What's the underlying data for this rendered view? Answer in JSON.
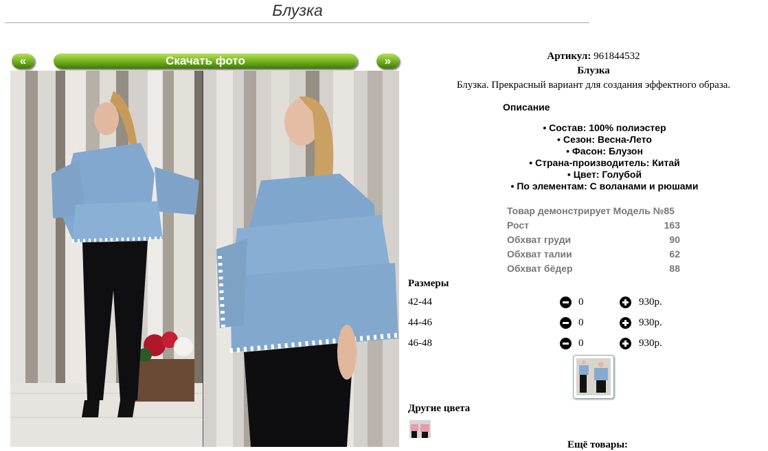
{
  "page": {
    "title": "Блузка"
  },
  "gallery": {
    "prev_label": "«",
    "download_label": "Скачать фото",
    "next_label": "»"
  },
  "product": {
    "article_label": "Артикул:",
    "article_value": "961844532",
    "name": "Блузка",
    "description": "Блузка. Прекрасный вариант для создания эффектного образа.",
    "description_heading": "Описание",
    "properties": [
      "Состав: 100% полиэстер",
      "Сезон: Весна-Лето",
      "Фасон: Блузон",
      "Страна-производитель: Китай",
      "Цвет: Голубой",
      "По элементам: С воланами и рюшами"
    ]
  },
  "model": {
    "rows": [
      {
        "label": "Товар демонстрирует Модель №85",
        "value": ""
      },
      {
        "label": "Рост",
        "value": "163"
      },
      {
        "label": "Обхват груди",
        "value": "90"
      },
      {
        "label": "Обхват талии",
        "value": "62"
      },
      {
        "label": "Обхват бёдер",
        "value": "88"
      }
    ]
  },
  "sizes": {
    "heading": "Размеры",
    "rows": [
      {
        "size": "42-44",
        "qty": "0",
        "price": "930р."
      },
      {
        "size": "44-46",
        "qty": "0",
        "price": "930р."
      },
      {
        "size": "46-48",
        "qty": "0",
        "price": "930р."
      }
    ]
  },
  "other_colors": {
    "heading": "Другие цвета"
  },
  "more": {
    "heading": "Ещё товары:"
  },
  "colors": {
    "button_green": "#6aa81c",
    "blouse_blue": "#7fa6cc"
  }
}
